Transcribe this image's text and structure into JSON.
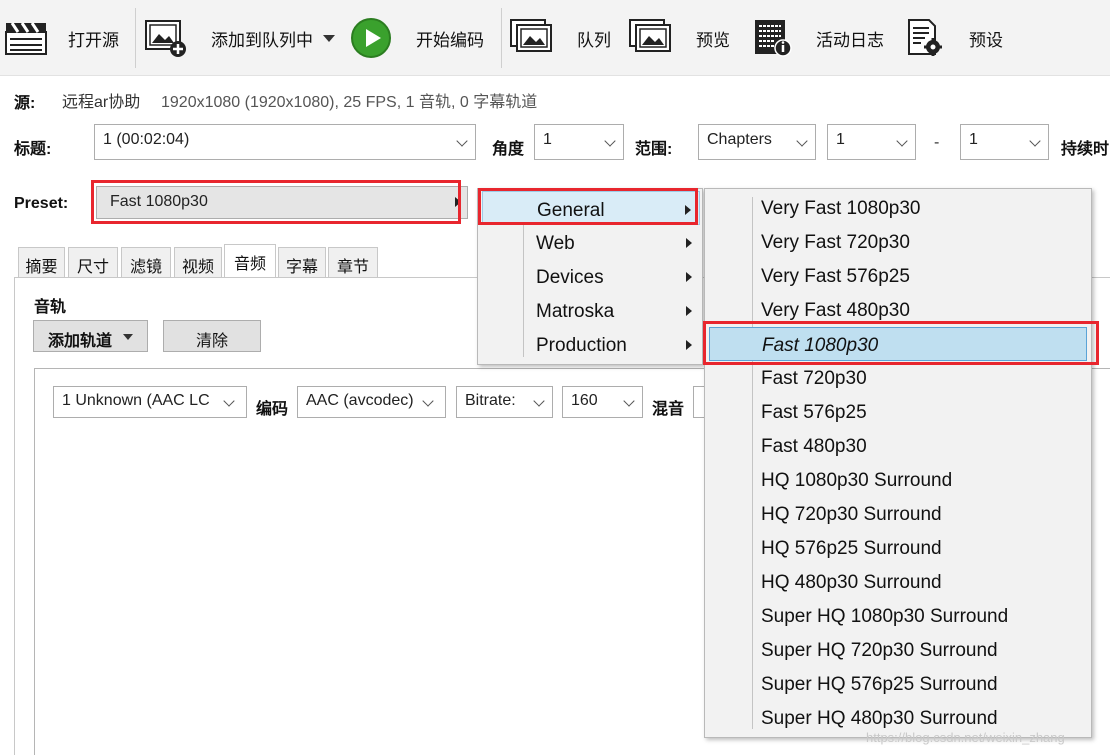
{
  "toolbar": {
    "open_source": "打开源",
    "add_to_queue": "添加到队列中",
    "start_encode": "开始编码",
    "queue": "队列",
    "preview": "预览",
    "activity_log": "活动日志",
    "presets": "预设"
  },
  "source": {
    "label": "源:",
    "name": "远程ar协助",
    "info": "1920x1080 (1920x1080), 25 FPS, 1 音轨, 0 字幕轨道"
  },
  "title_row": {
    "title_label": "标题:",
    "title_value": "1  (00:02:04)",
    "angle_label": "角度",
    "angle_value": "1",
    "range_label": "范围:",
    "range_type": "Chapters",
    "range_start": "1",
    "range_dash": "-",
    "range_end": "1",
    "duration_label": "持续时"
  },
  "preset": {
    "label": "Preset:",
    "value": "Fast 1080p30"
  },
  "tabs": [
    "摘要",
    "尺寸",
    "滤镜",
    "视频",
    "音频",
    "字幕",
    "章节"
  ],
  "active_tab": "音频",
  "audio": {
    "section_title": "音轨",
    "add_track": "添加轨道",
    "clear": "清除",
    "track_source": "1 Unknown (AAC LC",
    "codec_label": "编码",
    "codec_value": "AAC (avcodec)",
    "bitrate_label": "Bitrate:",
    "bitrate_value": "160",
    "mixdown_label": "混音"
  },
  "menu_categories": [
    "General",
    "Web",
    "Devices",
    "Matroska",
    "Production"
  ],
  "menu_selected_category": "General",
  "menu_presets": [
    "Very Fast 1080p30",
    "Very Fast 720p30",
    "Very Fast 576p25",
    "Very Fast 480p30",
    "Fast 1080p30",
    "Fast 720p30",
    "Fast 576p25",
    "Fast 480p30",
    "HQ 1080p30 Surround",
    "HQ 720p30 Surround",
    "HQ 576p25 Surround",
    "HQ 480p30 Surround",
    "Super HQ 1080p30 Surround",
    "Super HQ 720p30 Surround",
    "Super HQ 576p25 Surround",
    "Super HQ 480p30 Surround"
  ],
  "menu_selected_preset": "Fast 1080p30",
  "watermark": "https://blog.csdn.net/weixin_zhang",
  "colors": {
    "highlight_red": "#e8262e",
    "selected_item_bg": "#bfdff0",
    "selected_item_border": "#5aa3d6",
    "play_green": "#3aa12d"
  }
}
